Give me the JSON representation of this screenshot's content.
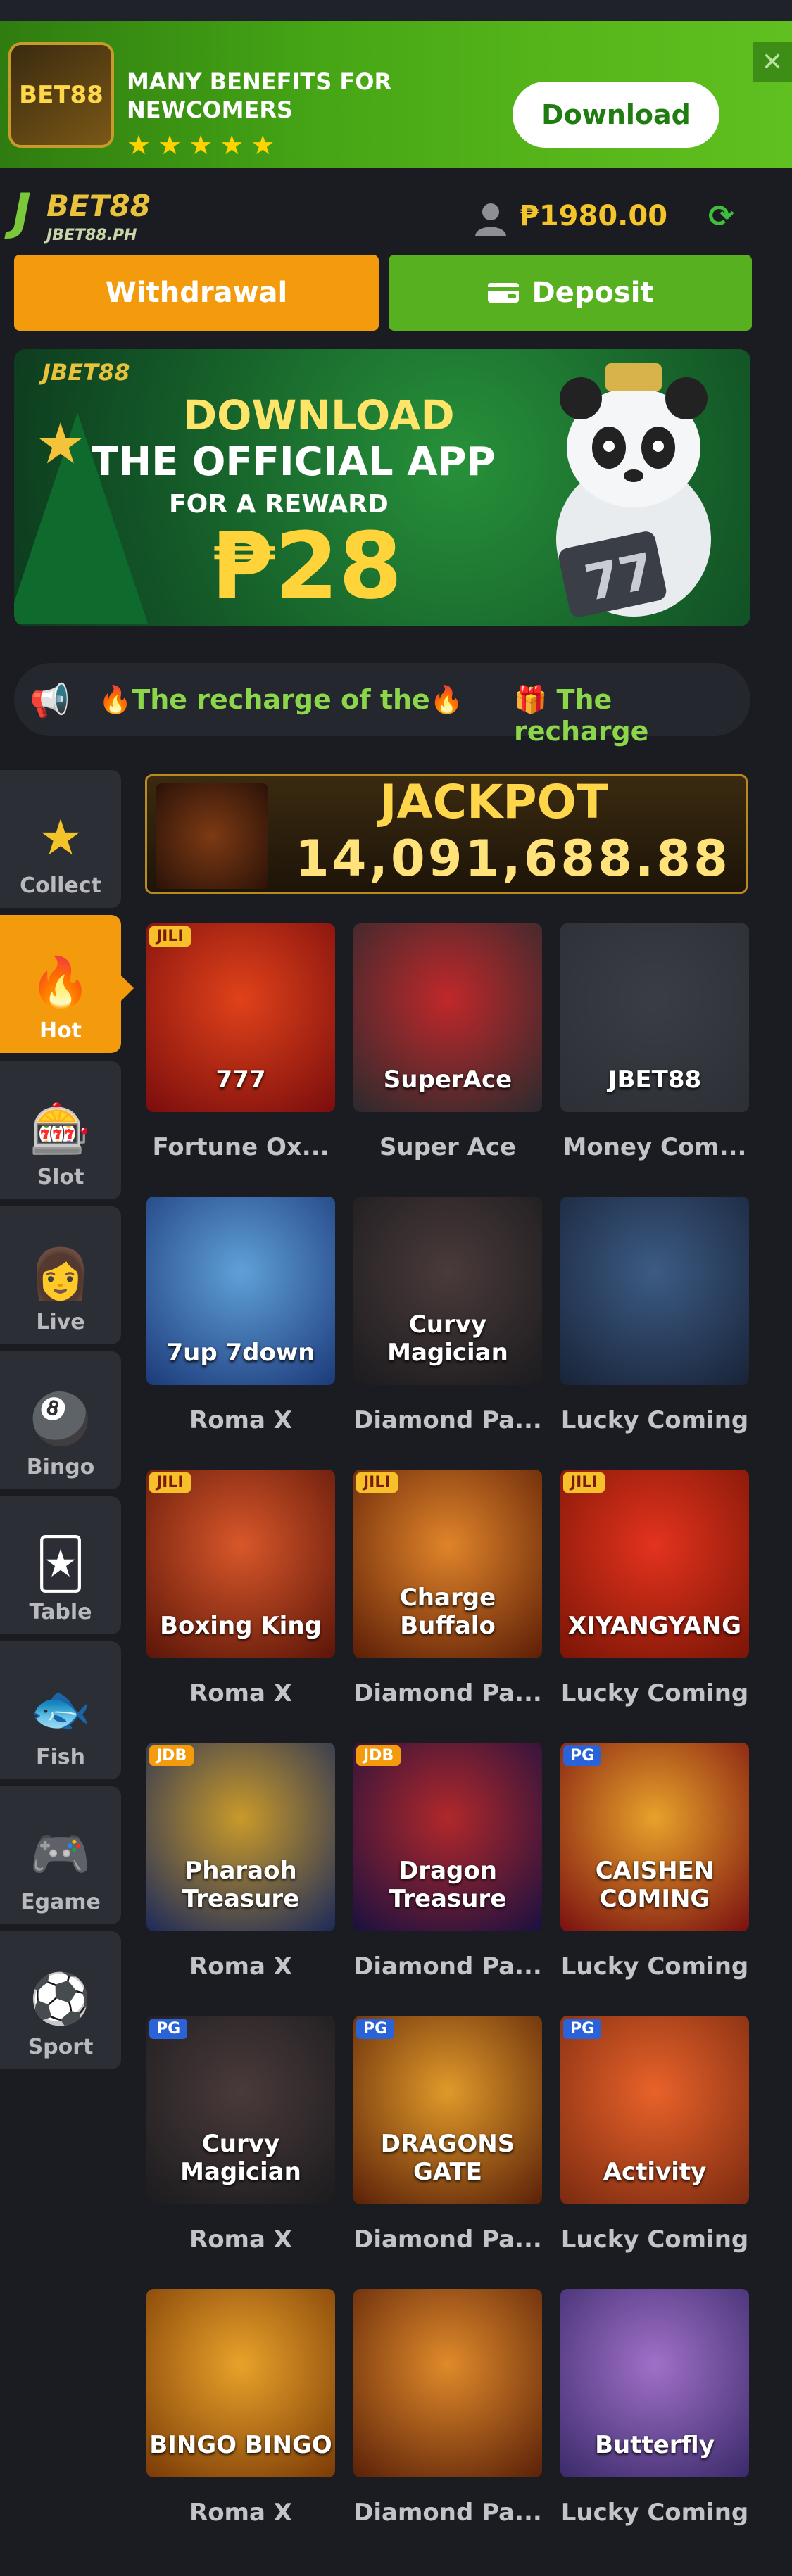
{
  "promo": {
    "title": "MANY BENEFITS FOR NEWCOMERS",
    "stars": "★★★★★",
    "download_label": "Download",
    "close": "✕"
  },
  "header": {
    "logo_mark": "J",
    "logo_name": "BET88",
    "logo_sub": "JBET88.PH",
    "balance": "₱1980.00",
    "refresh": "⟳"
  },
  "actions": {
    "withdraw_label": "Withdrawal",
    "deposit_label": "Deposit"
  },
  "hero": {
    "logo": "JBET88",
    "line1": "DOWNLOAD",
    "line2": "THE OFFICIAL APP",
    "line3": "FOR A REWARD",
    "line4": "₱28"
  },
  "marquee": {
    "text1": "🔥The recharge of the🔥",
    "text2": "🎁 The recharge"
  },
  "sidebar": {
    "items": [
      {
        "label": "Collect",
        "icon": "★"
      },
      {
        "label": "Hot",
        "icon": "🔥"
      },
      {
        "label": "Slot",
        "icon": "🎰"
      },
      {
        "label": "Live",
        "icon": "👩"
      },
      {
        "label": "Bingo",
        "icon": "🎱"
      },
      {
        "label": "Table",
        "icon": "🃏"
      },
      {
        "label": "Fish",
        "icon": "🐟"
      },
      {
        "label": "Egame",
        "icon": "🎮"
      },
      {
        "label": "Sport",
        "icon": "⚽"
      }
    ]
  },
  "jackpot": {
    "title": "JACKPOT",
    "value": "14,091,688.88"
  },
  "games": [
    {
      "name": "Fortune Ox...",
      "art": "777",
      "badge": "JILI"
    },
    {
      "name": "Super Ace",
      "art": "SuperAce",
      "badge": ""
    },
    {
      "name": "Money Com...",
      "art": "JBET88",
      "badge": ""
    },
    {
      "name": "Roma X",
      "art": "7up 7down",
      "badge": ""
    },
    {
      "name": "Diamond Pa...",
      "art": "Curvy Magician",
      "badge": ""
    },
    {
      "name": "Lucky Coming",
      "art": "",
      "badge": ""
    },
    {
      "name": "Roma X",
      "art": "Boxing King",
      "badge": "JILI"
    },
    {
      "name": "Diamond Pa...",
      "art": "Charge Buffalo",
      "badge": "JILI"
    },
    {
      "name": "Lucky Coming",
      "art": "XIYANGYANG",
      "badge": "JILI"
    },
    {
      "name": "Roma X",
      "art": "Pharaoh Treasure",
      "badge": "JDB"
    },
    {
      "name": "Diamond Pa...",
      "art": "Dragon Treasure",
      "badge": "JDB"
    },
    {
      "name": "Lucky Coming",
      "art": "CAISHEN COMING",
      "badge": "PG"
    },
    {
      "name": "Roma X",
      "art": "Curvy Magician",
      "badge": "PG"
    },
    {
      "name": "Diamond Pa...",
      "art": "DRAGONS GATE",
      "badge": "PG"
    },
    {
      "name": "Lucky Coming",
      "art": "Activity",
      "badge": "PG"
    },
    {
      "name": "Roma X",
      "art": "BINGO BINGO",
      "badge": ""
    },
    {
      "name": "Diamond Pa...",
      "art": "",
      "badge": ""
    },
    {
      "name": "Lucky Coming",
      "art": "Butterfly",
      "badge": ""
    }
  ],
  "colors": {
    "accent_orange": "#f39b0c",
    "accent_green": "#56b01f",
    "gold": "#f4c52a",
    "background": "#1a1c21"
  }
}
